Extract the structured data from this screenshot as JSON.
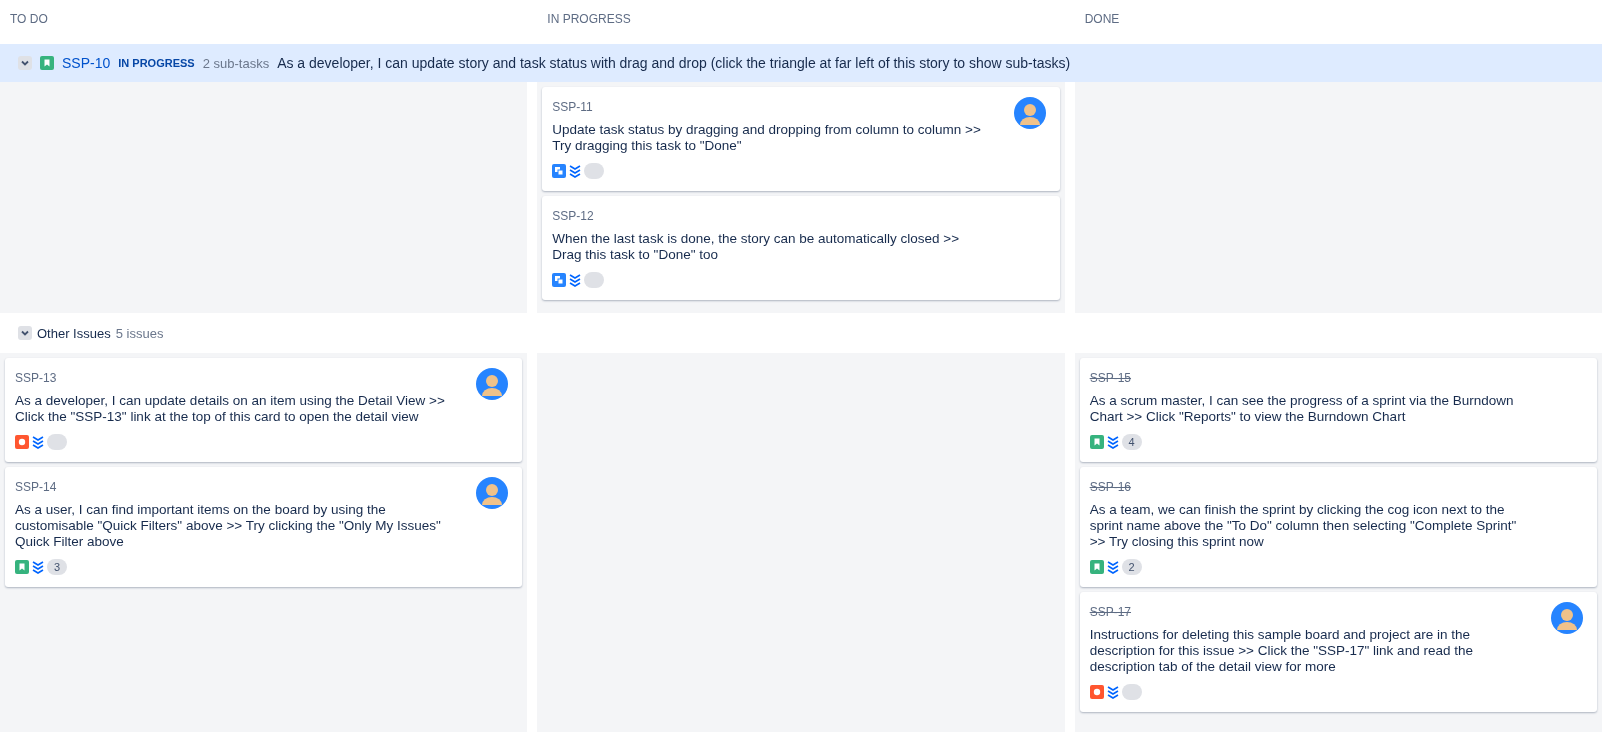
{
  "columns": [
    {
      "title": "TO DO"
    },
    {
      "title": "IN PROGRESS"
    },
    {
      "title": "DONE"
    }
  ],
  "swimlanes": [
    {
      "kind": "story",
      "expanded": true,
      "issue": {
        "kind": "story",
        "key": "SSP-10",
        "status": "IN PROGRESS",
        "count": "2 sub-tasks",
        "summary": "As a developer, I can update story and task status with drag and drop (click the triangle at far left of this story to show sub-tasks)"
      },
      "cells": [
        [],
        [
          {
            "key": "SSP-11",
            "done": false,
            "summary": "Update task status by dragging and dropping from column to column >> Try dragging this task to \"Done\"",
            "kind": "subtask",
            "assigned": true
          },
          {
            "key": "SSP-12",
            "done": false,
            "summary": "When the last task is done, the story can be automatically closed >> Drag this task to \"Done\" too",
            "kind": "subtask",
            "assigned": false
          }
        ],
        []
      ]
    },
    {
      "kind": "group",
      "expanded": true,
      "label": "Other Issues",
      "count": "5 issues",
      "cells": [
        [
          {
            "key": "SSP-13",
            "done": false,
            "summary": "As a developer, I can update details on an item using the Detail View >> Click the \"SSP-13\" link at the top of this card to open the detail view",
            "kind": "bug",
            "assigned": true
          },
          {
            "key": "SSP-14",
            "done": false,
            "summary": "As a user, I can find important items on the board by using the customisable \"Quick Filters\" above >> Try clicking the \"Only My Issues\" Quick Filter above",
            "kind": "story",
            "estimate": "3",
            "assigned": true
          }
        ],
        [],
        [
          {
            "key": "SSP-15",
            "done": true,
            "summary": "As a scrum master, I can see the progress of a sprint via the Burndown Chart >> Click \"Reports\" to view the Burndown Chart",
            "kind": "story",
            "estimate": "4",
            "assigned": false
          },
          {
            "key": "SSP-16",
            "done": true,
            "summary": "As a team, we can finish the sprint by clicking the cog icon next to the sprint name above the \"To Do\" column then selecting \"Complete Sprint\" >> Try closing this sprint now",
            "kind": "story",
            "estimate": "2",
            "assigned": false
          },
          {
            "key": "SSP-17",
            "done": true,
            "summary": "Instructions for deleting this sample board and project are in the description for this issue >> Click the \"SSP-17\" link and read the description tab of the detail view for more",
            "kind": "bug",
            "assigned": true
          }
        ]
      ]
    }
  ]
}
